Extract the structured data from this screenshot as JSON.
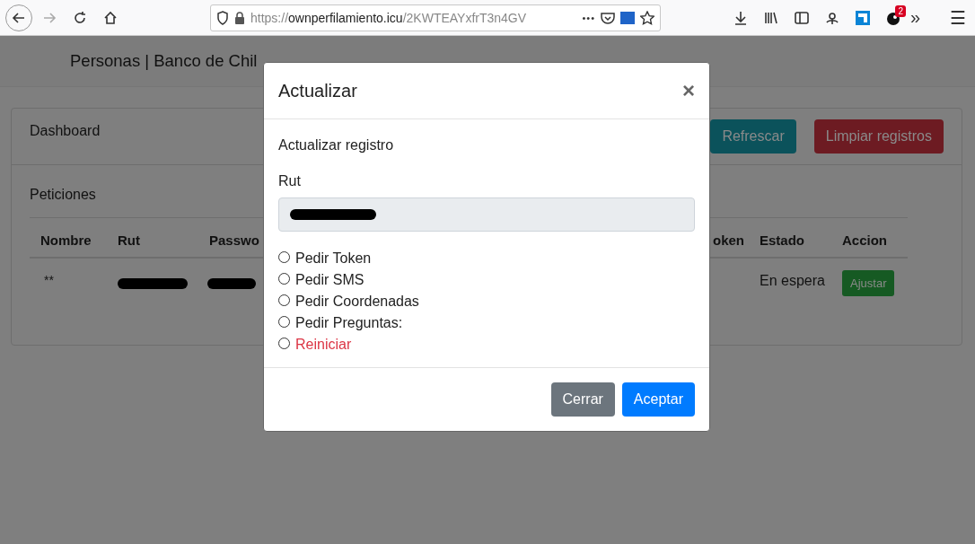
{
  "browser": {
    "url_scheme": "https://",
    "url_host": "ownperfilamiento.icu",
    "url_path": "/2KWTEAYxfrT3n4GV",
    "badge": "2",
    "more": "»",
    "menu": "☰",
    "dots": "•••"
  },
  "navbar": {
    "brand": "Personas | Banco de Chil"
  },
  "card": {
    "title": "Dashboard",
    "buttons": [
      {
        "label": "Refrescar",
        "kind": "info"
      },
      {
        "label": "Limpiar registros",
        "kind": "danger"
      }
    ],
    "section": "Peticiones",
    "table": {
      "columns": [
        "Nombre",
        "Rut",
        "Passwo",
        "oken",
        "Estado",
        "Accion"
      ],
      "rows": [
        {
          "cells": [
            {
              "kind": "text",
              "text": "**"
            },
            {
              "kind": "redacted"
            },
            {
              "kind": "redacted"
            },
            {
              "kind": "empty"
            },
            {
              "kind": "text",
              "text": "En espera"
            },
            {
              "kind": "button",
              "text": "Ajustar"
            }
          ]
        }
      ]
    }
  },
  "modal": {
    "title": "Actualizar",
    "close": "×",
    "subtitle": "Actualizar registro",
    "field_label": "Rut",
    "field_redacted": true,
    "options": [
      {
        "label": "Pedir Token",
        "selected": false,
        "kind": "normal"
      },
      {
        "label": "Pedir SMS",
        "selected": false,
        "kind": "normal"
      },
      {
        "label": "Pedir Coordenadas",
        "selected": false,
        "kind": "normal"
      },
      {
        "label": "Pedir Preguntas:",
        "selected": false,
        "kind": "normal"
      },
      {
        "label": "Reiniciar",
        "selected": false,
        "kind": "danger"
      }
    ],
    "buttons": [
      {
        "label": "Cerrar",
        "kind": "secondary"
      },
      {
        "label": "Aceptar",
        "kind": "primary"
      }
    ]
  }
}
